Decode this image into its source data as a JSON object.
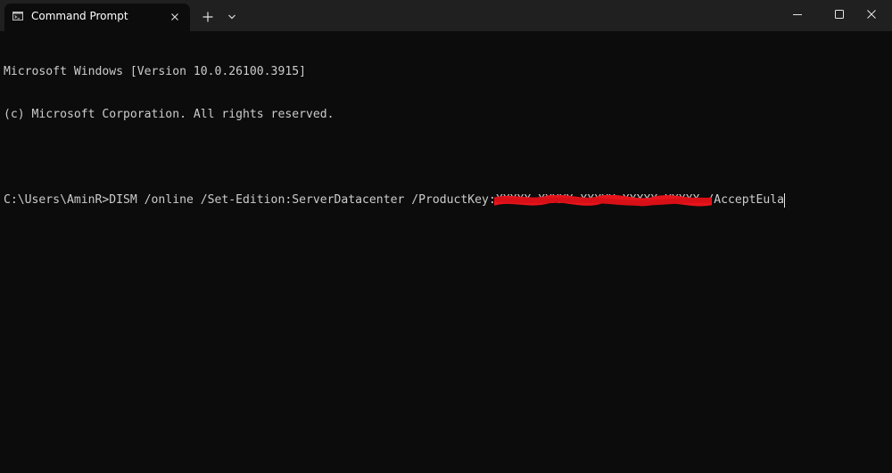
{
  "window": {
    "tab_title": "Command Prompt",
    "icons": {
      "tab_icon": "cmd-terminal-icon",
      "tab_close": "close-icon",
      "new_tab": "plus-icon",
      "dropdown": "chevron-down-icon",
      "minimize": "minimize-icon",
      "maximize": "maximize-icon",
      "close": "close-icon"
    }
  },
  "terminal": {
    "line1": "Microsoft Windows [Version 10.0.26100.3915]",
    "line2": "(c) Microsoft Corporation. All rights reserved.",
    "prompt": "C:\\Users\\AminR>",
    "command_prefix": "DISM /online /Set-Edition:ServerDatacenter /ProductKey:",
    "product_key": "XXXXX-XXXXX-XXXXX-XXXXX-XXXXX",
    "command_suffix": " /AcceptEula"
  },
  "colors": {
    "background": "#0c0c0c",
    "titlebar": "#202020",
    "text": "#cccccc",
    "redaction": "#e8141b"
  }
}
